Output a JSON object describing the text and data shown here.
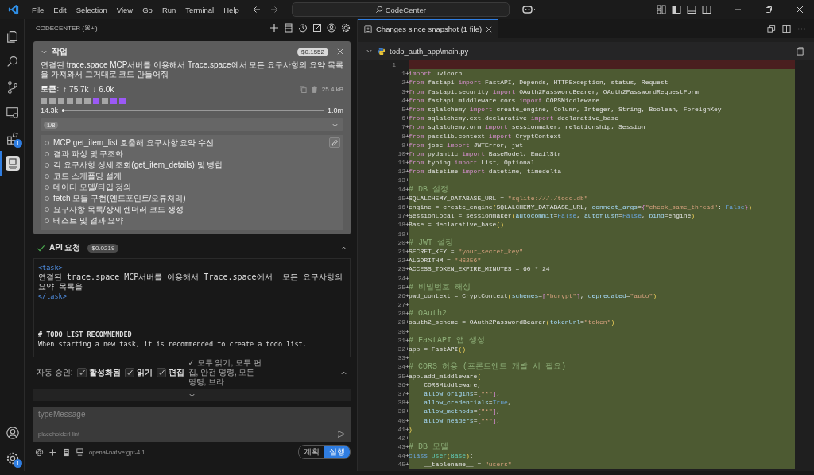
{
  "title_bar": {
    "menu": [
      "File",
      "Edit",
      "Selection",
      "View",
      "Go",
      "Run",
      "Terminal",
      "Help"
    ],
    "search": "CodeCenter"
  },
  "activity_bar": {
    "items": [
      {
        "selected": false
      },
      {
        "selected": false
      },
      {
        "selected": false
      },
      {
        "selected": false
      },
      {
        "selected": false,
        "badge": "1"
      },
      {
        "selected": true
      }
    ],
    "settings_badge": "1"
  },
  "sidebar": {
    "title": "CODECENTER (⌘+')",
    "task": {
      "heading": "작업",
      "expanded": true,
      "cost": "$0.1552",
      "text": "연결된 trace.space MCP서버를 이용해서 Trace.space에서  모든 요구사항의 요약 목록을 가져와서 그거대로 코드 만들어줘",
      "tokens_label": "토큰:",
      "tokens_up": "↑ 75.7k",
      "tokens_down": "↓ 6.0k",
      "size": "25.4 kB",
      "context_blocks": [
        {
          "color": "#a6a6a6"
        },
        {
          "color": "#a6a6a6"
        },
        {
          "color": "#a6a6a6"
        },
        {
          "color": "#a6a6a6"
        },
        {
          "color": "#a6a6a6"
        },
        {
          "color": "#a6a6a6"
        },
        {
          "color": "#9b59f5"
        },
        {
          "color": "#a6a6a6"
        },
        {
          "color": "#9b59f5"
        },
        {
          "color": "#9b59f5"
        }
      ],
      "context": {
        "used": "14.3k",
        "level": 0.01,
        "max": "1.0m"
      },
      "todo_count": "1/8",
      "todos": [
        {
          "text": "MCP get_item_list 호출해 요구사항 요약 수신",
          "checked": false
        },
        {
          "text": "결과 파싱 및 구조화",
          "checked": false
        },
        {
          "text": "각 요구사항 상세 조회(get_item_details) 및 병합",
          "checked": false
        },
        {
          "text": "코드 스캐폴딩 설계",
          "checked": false
        },
        {
          "text": "데이터 모델/타입 정의",
          "checked": false
        },
        {
          "text": "fetch 모듈 구현(엔드포인트/오류처리)",
          "checked": false
        },
        {
          "text": "요구사항 목록/상세 렌더러 코드 생성",
          "checked": false
        },
        {
          "text": "테스트 및 결과 요약",
          "checked": false
        }
      ]
    },
    "api_request": {
      "title": "API 요청",
      "done": true,
      "cost": "$0.0219",
      "expanded": true,
      "lines": [
        {
          "kind": "tag",
          "text": "<task>"
        },
        {
          "kind": "text",
          "text": "연결된 trace.space MCP서버를 이용해서 Trace.space에서  모든 요구사항의 요약 목록을"
        },
        {
          "kind": "tag",
          "text": "</task>"
        },
        {
          "kind": "blank"
        },
        {
          "kind": "blank"
        },
        {
          "kind": "blank"
        },
        {
          "kind": "heading",
          "text": "# TODO LIST RECOMMENDED"
        },
        {
          "kind": "text",
          "text": "When starting a new task, it is recommended to create a todo list."
        }
      ]
    },
    "auto_approve": {
      "label": "자동 승인:",
      "options": [
        {
          "label": "활성화됨",
          "checked": true
        },
        {
          "label": "읽기",
          "checked": true
        },
        {
          "label": "편집",
          "checked": true
        }
      ],
      "summary": "✓ 모두 읽기, 모두 편집, 안전 명령, 모든 명령, 브라"
    },
    "input": {
      "placeholder": "typeMessage",
      "hint": "placeholderHint"
    },
    "model": "openai-native:gpt-4.1",
    "modes": [
      {
        "label": "계획",
        "selected": false
      },
      {
        "label": "실행",
        "selected": true
      }
    ]
  },
  "editor": {
    "tab": "Changes since snapshot (1 file)",
    "file": "todo_auth_app\\main.py",
    "lines": [
      {
        "kind": "removed",
        "old": "1"
      },
      {
        "kind": "added",
        "n": "1",
        "mark": "+",
        "tokens": [
          {
            "text": "import",
            "kind": "keyword"
          },
          {
            "text": " uvicorn",
            "kind": "plain"
          }
        ]
      },
      {
        "kind": "added",
        "n": "2",
        "mark": "+",
        "tokens": [
          {
            "text": "from",
            "kind": "keyword"
          },
          {
            "text": " fastapi ",
            "kind": "plain"
          },
          {
            "text": "import",
            "kind": "keyword"
          },
          {
            "text": " FastAPI, Depends, HTTPException, status, Request",
            "kind": "plain"
          }
        ]
      },
      {
        "kind": "added",
        "n": "3",
        "mark": "+",
        "tokens": [
          {
            "text": "from",
            "kind": "keyword"
          },
          {
            "text": " fastapi.security ",
            "kind": "plain"
          },
          {
            "text": "import",
            "kind": "keyword"
          },
          {
            "text": " OAuth2PasswordBearer, OAuth2PasswordRequestForm",
            "kind": "plain"
          }
        ]
      },
      {
        "kind": "added",
        "n": "4",
        "mark": "+",
        "tokens": [
          {
            "text": "from",
            "kind": "keyword"
          },
          {
            "text": " fastapi.middleware.cors ",
            "kind": "plain"
          },
          {
            "text": "import",
            "kind": "keyword"
          },
          {
            "text": " CORSMiddleware",
            "kind": "plain"
          }
        ]
      },
      {
        "kind": "added",
        "n": "5",
        "mark": "+",
        "tokens": [
          {
            "text": "from",
            "kind": "keyword"
          },
          {
            "text": " sqlalchemy ",
            "kind": "plain"
          },
          {
            "text": "import",
            "kind": "keyword"
          },
          {
            "text": " create_engine, Column, Integer, String, Boolean, ForeignKey",
            "kind": "plain"
          }
        ]
      },
      {
        "kind": "added",
        "n": "6",
        "mark": "+",
        "tokens": [
          {
            "text": "from",
            "kind": "keyword"
          },
          {
            "text": " sqlalchemy.ext.declarative ",
            "kind": "plain"
          },
          {
            "text": "import",
            "kind": "keyword"
          },
          {
            "text": " declarative_base",
            "kind": "plain"
          }
        ]
      },
      {
        "kind": "added",
        "n": "7",
        "mark": "+",
        "tokens": [
          {
            "text": "from",
            "kind": "keyword"
          },
          {
            "text": " sqlalchemy.orm ",
            "kind": "plain"
          },
          {
            "text": "import",
            "kind": "keyword"
          },
          {
            "text": " sessionmaker, relationship, Session",
            "kind": "plain"
          }
        ]
      },
      {
        "kind": "added",
        "n": "8",
        "mark": "+",
        "tokens": [
          {
            "text": "from",
            "kind": "keyword"
          },
          {
            "text": " passlib.context ",
            "kind": "plain"
          },
          {
            "text": "import",
            "kind": "keyword"
          },
          {
            "text": " CryptContext",
            "kind": "plain"
          }
        ]
      },
      {
        "kind": "added",
        "n": "9",
        "mark": "+",
        "tokens": [
          {
            "text": "from",
            "kind": "keyword"
          },
          {
            "text": " jose ",
            "kind": "plain"
          },
          {
            "text": "import",
            "kind": "keyword"
          },
          {
            "text": " JWTError, jwt",
            "kind": "plain"
          }
        ]
      },
      {
        "kind": "added",
        "n": "10",
        "mark": "+",
        "tokens": [
          {
            "text": "from",
            "kind": "keyword"
          },
          {
            "text": " pydantic ",
            "kind": "plain"
          },
          {
            "text": "import",
            "kind": "keyword"
          },
          {
            "text": " BaseModel, EmailStr",
            "kind": "plain"
          }
        ]
      },
      {
        "kind": "added",
        "n": "11",
        "mark": "+",
        "tokens": [
          {
            "text": "from",
            "kind": "keyword"
          },
          {
            "text": " typing ",
            "kind": "plain"
          },
          {
            "text": "import",
            "kind": "keyword"
          },
          {
            "text": " List, Optional",
            "kind": "plain"
          }
        ]
      },
      {
        "kind": "added",
        "n": "12",
        "mark": "+",
        "tokens": [
          {
            "text": "from",
            "kind": "keyword"
          },
          {
            "text": " datetime ",
            "kind": "plain"
          },
          {
            "text": "import",
            "kind": "keyword"
          },
          {
            "text": " datetime, timedelta",
            "kind": "plain"
          }
        ]
      },
      {
        "kind": "added",
        "n": "13",
        "mark": "+"
      },
      {
        "kind": "added",
        "n": "14",
        "mark": "+",
        "tokens": [
          {
            "text": "# DB 설정",
            "kind": "comment"
          }
        ]
      },
      {
        "kind": "added",
        "n": "15",
        "mark": "+",
        "tokens": [
          {
            "text": "SQLALCHEMY_DATABASE_URL = ",
            "kind": "plain"
          },
          {
            "text": "\"sqlite:///./todo.db\"",
            "kind": "string"
          }
        ]
      },
      {
        "kind": "added",
        "n": "16",
        "mark": "+",
        "tokens": [
          {
            "text": "engine = create_engine",
            "kind": "plain"
          },
          {
            "text": "(",
            "kind": "paren"
          },
          {
            "text": "SQLALCHEMY_DATABASE_URL, ",
            "kind": "plain"
          },
          {
            "text": "connect_args",
            "kind": "param"
          },
          {
            "text": "=",
            "kind": "plain"
          },
          {
            "text": "{",
            "kind": "bracket"
          },
          {
            "text": "\"check_same_thread\"",
            "kind": "string"
          },
          {
            "text": ": ",
            "kind": "plain"
          },
          {
            "text": "False",
            "kind": "constant"
          },
          {
            "text": "}",
            "kind": "bracket"
          },
          {
            "text": ")",
            "kind": "paren"
          }
        ]
      },
      {
        "kind": "added",
        "n": "17",
        "mark": "+",
        "tokens": [
          {
            "text": "SessionLocal = sessionmaker",
            "kind": "plain"
          },
          {
            "text": "(",
            "kind": "paren"
          },
          {
            "text": "autocommit",
            "kind": "param"
          },
          {
            "text": "=",
            "kind": "plain"
          },
          {
            "text": "False",
            "kind": "constant"
          },
          {
            "text": ", ",
            "kind": "plain"
          },
          {
            "text": "autoflush",
            "kind": "param"
          },
          {
            "text": "=",
            "kind": "plain"
          },
          {
            "text": "False",
            "kind": "constant"
          },
          {
            "text": ", ",
            "kind": "plain"
          },
          {
            "text": "bind",
            "kind": "param"
          },
          {
            "text": "=engine",
            "kind": "plain"
          },
          {
            "text": ")",
            "kind": "paren"
          }
        ]
      },
      {
        "kind": "added",
        "n": "18",
        "mark": "+",
        "tokens": [
          {
            "text": "Base = declarative_base",
            "kind": "plain"
          },
          {
            "text": "()",
            "kind": "paren"
          }
        ]
      },
      {
        "kind": "added",
        "n": "19",
        "mark": "+"
      },
      {
        "kind": "added",
        "n": "20",
        "mark": "+",
        "tokens": [
          {
            "text": "# JWT 설정",
            "kind": "comment"
          }
        ]
      },
      {
        "kind": "added",
        "n": "21",
        "mark": "+",
        "tokens": [
          {
            "text": "SECRET_KEY = ",
            "kind": "plain"
          },
          {
            "text": "\"your_secret_key\"",
            "kind": "string"
          }
        ]
      },
      {
        "kind": "added",
        "n": "22",
        "mark": "+",
        "tokens": [
          {
            "text": "ALGORITHM = ",
            "kind": "plain"
          },
          {
            "text": "\"HS256\"",
            "kind": "string"
          }
        ]
      },
      {
        "kind": "added",
        "n": "23",
        "mark": "+",
        "tokens": [
          {
            "text": "ACCESS_TOKEN_EXPIRE_MINUTES = 60 * 24",
            "kind": "plain"
          }
        ]
      },
      {
        "kind": "added",
        "n": "24",
        "mark": "+"
      },
      {
        "kind": "added",
        "n": "25",
        "mark": "+",
        "tokens": [
          {
            "text": "# 비밀번호 해싱",
            "kind": "comment"
          }
        ]
      },
      {
        "kind": "added",
        "n": "26",
        "mark": "+",
        "tokens": [
          {
            "text": "pwd_context = CryptContext",
            "kind": "plain"
          },
          {
            "text": "(",
            "kind": "paren"
          },
          {
            "text": "schemes",
            "kind": "param"
          },
          {
            "text": "=",
            "kind": "plain"
          },
          {
            "text": "[",
            "kind": "bracket"
          },
          {
            "text": "\"bcrypt\"",
            "kind": "string"
          },
          {
            "text": "]",
            "kind": "bracket"
          },
          {
            "text": ", ",
            "kind": "plain"
          },
          {
            "text": "deprecated",
            "kind": "param"
          },
          {
            "text": "=",
            "kind": "plain"
          },
          {
            "text": "\"auto\"",
            "kind": "string"
          },
          {
            "text": ")",
            "kind": "paren"
          }
        ]
      },
      {
        "kind": "added",
        "n": "27",
        "mark": "+"
      },
      {
        "kind": "added",
        "n": "28",
        "mark": "+",
        "tokens": [
          {
            "text": "# OAuth2",
            "kind": "comment"
          }
        ]
      },
      {
        "kind": "added",
        "n": "29",
        "mark": "+",
        "tokens": [
          {
            "text": "oauth2_scheme = OAuth2PasswordBearer",
            "kind": "plain"
          },
          {
            "text": "(",
            "kind": "paren"
          },
          {
            "text": "tokenUrl",
            "kind": "param"
          },
          {
            "text": "=",
            "kind": "plain"
          },
          {
            "text": "\"token\"",
            "kind": "string"
          },
          {
            "text": ")",
            "kind": "paren"
          }
        ]
      },
      {
        "kind": "added",
        "n": "30",
        "mark": "+"
      },
      {
        "kind": "added",
        "n": "31",
        "mark": "+",
        "tokens": [
          {
            "text": "# FastAPI 앱 생성",
            "kind": "comment"
          }
        ]
      },
      {
        "kind": "added",
        "n": "32",
        "mark": "+",
        "tokens": [
          {
            "text": "app = FastAPI",
            "kind": "plain"
          },
          {
            "text": "()",
            "kind": "paren"
          }
        ]
      },
      {
        "kind": "added",
        "n": "33",
        "mark": "+"
      },
      {
        "kind": "added",
        "n": "34",
        "mark": "+",
        "tokens": [
          {
            "text": "# CORS 허용 (프론트엔드 개발 시 필요)",
            "kind": "comment"
          }
        ]
      },
      {
        "kind": "added",
        "n": "35",
        "mark": "+",
        "tokens": [
          {
            "text": "app.add_middleware",
            "kind": "plain"
          },
          {
            "text": "(",
            "kind": "paren"
          }
        ]
      },
      {
        "kind": "added",
        "n": "36",
        "mark": "+",
        "indented": true,
        "tokens": [
          {
            "text": "CORSMiddleware,",
            "kind": "plain"
          }
        ]
      },
      {
        "kind": "added",
        "n": "37",
        "mark": "+",
        "indented": true,
        "tokens": [
          {
            "text": "allow_origins",
            "kind": "param"
          },
          {
            "text": "=",
            "kind": "plain"
          },
          {
            "text": "[",
            "kind": "bracket"
          },
          {
            "text": "\"*\"",
            "kind": "string"
          },
          {
            "text": "]",
            "kind": "bracket"
          },
          {
            "text": ",",
            "kind": "plain"
          }
        ]
      },
      {
        "kind": "added",
        "n": "38",
        "mark": "+",
        "indented": true,
        "tokens": [
          {
            "text": "allow_credentials",
            "kind": "param"
          },
          {
            "text": "=",
            "kind": "plain"
          },
          {
            "text": "True",
            "kind": "constant"
          },
          {
            "text": ",",
            "kind": "plain"
          }
        ]
      },
      {
        "kind": "added",
        "n": "39",
        "mark": "+",
        "indented": true,
        "tokens": [
          {
            "text": "allow_methods",
            "kind": "param"
          },
          {
            "text": "=",
            "kind": "plain"
          },
          {
            "text": "[",
            "kind": "bracket"
          },
          {
            "text": "\"*\"",
            "kind": "string"
          },
          {
            "text": "]",
            "kind": "bracket"
          },
          {
            "text": ",",
            "kind": "plain"
          }
        ]
      },
      {
        "kind": "added",
        "n": "40",
        "mark": "+",
        "indented": true,
        "tokens": [
          {
            "text": "allow_headers",
            "kind": "param"
          },
          {
            "text": "=",
            "kind": "plain"
          },
          {
            "text": "[",
            "kind": "bracket"
          },
          {
            "text": "\"*\"",
            "kind": "string"
          },
          {
            "text": "]",
            "kind": "bracket"
          },
          {
            "text": ",",
            "kind": "plain"
          }
        ]
      },
      {
        "kind": "added",
        "n": "41",
        "mark": "+",
        "tokens": [
          {
            "text": ")",
            "kind": "paren"
          }
        ]
      },
      {
        "kind": "added",
        "n": "42",
        "mark": "+"
      },
      {
        "kind": "added",
        "n": "43",
        "mark": "+",
        "tokens": [
          {
            "text": "# DB 모델",
            "kind": "comment"
          }
        ]
      },
      {
        "kind": "added",
        "n": "44",
        "mark": "+",
        "tokens": [
          {
            "text": "class",
            "kind": "constant"
          },
          {
            "text": " User",
            "kind": "type"
          },
          {
            "text": "(",
            "kind": "paren"
          },
          {
            "text": "Base",
            "kind": "type"
          },
          {
            "text": ")",
            "kind": "paren"
          },
          {
            "text": ":",
            "kind": "plain"
          }
        ]
      },
      {
        "kind": "added",
        "n": "45",
        "mark": "+",
        "indented": true,
        "tokens": [
          {
            "text": "__tablename__ = ",
            "kind": "plain"
          },
          {
            "text": "\"users\"",
            "kind": "string"
          }
        ]
      }
    ]
  }
}
